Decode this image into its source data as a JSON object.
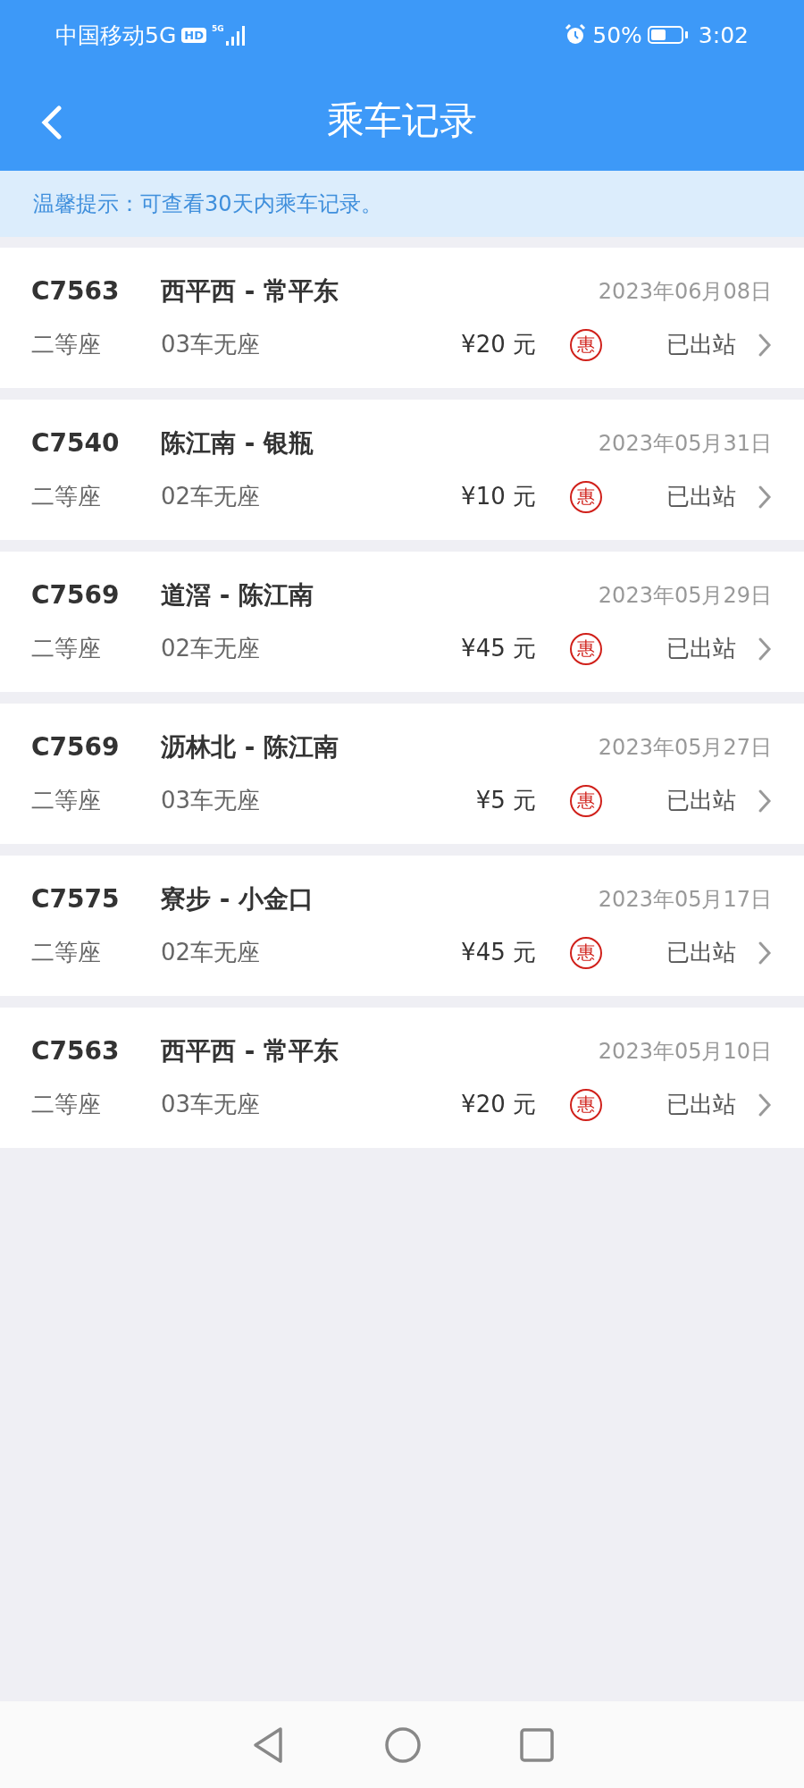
{
  "status_bar": {
    "carrier": "中国移动5G",
    "hd_badge": "HD",
    "signal_label": "5G",
    "battery_percent": "50%",
    "battery": {
      "level": 0.5
    },
    "time": "3:02"
  },
  "header": {
    "title": "乘车记录"
  },
  "tip": "温馨提示：可查看30天内乘车记录。",
  "trips": [
    {
      "train": "C7563",
      "route": "西平西 - 常平东",
      "date": "2023年06月08日",
      "seat_class": "二等座",
      "car": "03车无座",
      "price": "¥20 元",
      "badge": "惠",
      "status": "已出站"
    },
    {
      "train": "C7540",
      "route": "陈江南 - 银瓶",
      "date": "2023年05月31日",
      "seat_class": "二等座",
      "car": "02车无座",
      "price": "¥10 元",
      "badge": "惠",
      "status": "已出站"
    },
    {
      "train": "C7569",
      "route": "道滘 - 陈江南",
      "date": "2023年05月29日",
      "seat_class": "二等座",
      "car": "02车无座",
      "price": "¥45 元",
      "badge": "惠",
      "status": "已出站"
    },
    {
      "train": "C7569",
      "route": "沥林北 - 陈江南",
      "date": "2023年05月27日",
      "seat_class": "二等座",
      "car": "03车无座",
      "price": "¥5 元",
      "badge": "惠",
      "status": "已出站"
    },
    {
      "train": "C7575",
      "route": "寮步 - 小金口",
      "date": "2023年05月17日",
      "seat_class": "二等座",
      "car": "02车无座",
      "price": "¥45 元",
      "badge": "惠",
      "status": "已出站"
    },
    {
      "train": "C7563",
      "route": "西平西 - 常平东",
      "date": "2023年05月10日",
      "seat_class": "二等座",
      "car": "03车无座",
      "price": "¥20 元",
      "badge": "惠",
      "status": "已出站"
    }
  ]
}
